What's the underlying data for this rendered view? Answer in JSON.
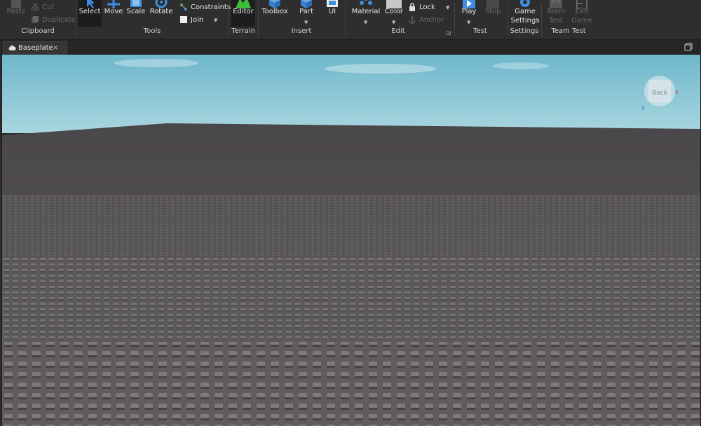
{
  "ribbon": {
    "clipboard": {
      "label": "Clipboard",
      "paste": "Paste",
      "cut": "Cut",
      "duplicate": "Duplicate"
    },
    "tools": {
      "label": "Tools",
      "select": "Select",
      "move": "Move",
      "scale": "Scale",
      "rotate": "Rotate",
      "constraints": "Constraints",
      "join": "Join"
    },
    "terrain": {
      "label": "Terrain",
      "editor": "Editor"
    },
    "insert": {
      "label": "Insert",
      "toolbox": "Toolbox",
      "part": "Part",
      "ui": "UI"
    },
    "edit": {
      "label": "Edit",
      "material": "Material",
      "color": "Color",
      "lock": "Lock",
      "anchor": "Anchor"
    },
    "test": {
      "label": "Test",
      "play": "Play",
      "stop": "Stop"
    },
    "settings": {
      "label": "Settings",
      "game_settings_1": "Game",
      "game_settings_2": "Settings"
    },
    "team_test": {
      "label": "Team Test",
      "team_test_1": "Team",
      "team_test_2": "Test",
      "exit_game_1": "Exit",
      "exit_game_2": "Game"
    }
  },
  "tabs": [
    {
      "label": "Baseplate",
      "close": "×"
    }
  ],
  "viewport": {
    "view_cube_face": "Back",
    "axis_z": "Z",
    "axis_x": "X",
    "sky_color": "#86c3d4",
    "ground_color": "#595658",
    "stud_color": "#7a7679"
  }
}
